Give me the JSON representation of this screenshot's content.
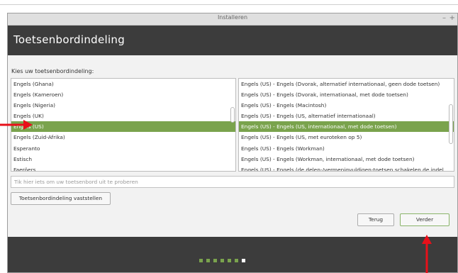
{
  "window": {
    "title": "Installeren",
    "min_symbol": "–",
    "close_symbol": "+"
  },
  "header": {
    "title": "Toetsenbordindeling"
  },
  "layout_label": "Kies uw toetsenbordindeling:",
  "layouts": [
    "Engels (Ghana)",
    "Engels (Kameroen)",
    "Engels (Nigeria)",
    "Engels (UK)",
    "Engels (US)",
    "Engels (Zuid-Afrika)",
    "Esperanto",
    "Estisch",
    "Faeröers"
  ],
  "selected_layout": "Engels (US)",
  "variants": [
    "Engels (US) - Engels (Dvorak, alternatief internationaal, geen dode toetsen)",
    "Engels (US) - Engels (Dvorak, internationaal, met dode toetsen)",
    "Engels (US) - Engels (Macintosh)",
    "Engels (US) - Engels (US, alternatief internationaal)",
    "Engels (US) - Engels (US, internationaal, met dode toetsen)",
    "Engels (US) - Engels (US, met euroteken op 5)",
    "Engels (US) - Engels (Workman)",
    "Engels (US) - Engels (Workman, internationaal, met dode toetsen)",
    "Engels (US) - Engels (de delen-/vermenigvuldigen-toetsen schakelen de indel"
  ],
  "selected_variant": "Engels (US) - Engels (US, internationaal, met dode toetsen)",
  "test_placeholder": "Tik hier iets om uw toetsenbord uit te proberen",
  "buttons": {
    "detect": "Toetsenbordindeling vaststellen",
    "back": "Terug",
    "next": "Verder"
  },
  "progress": {
    "total_steps": 7,
    "current_step": 7
  },
  "colors": {
    "accent": "#7aa34d",
    "header_bg": "#3c3c3c",
    "arrow": "#e8101a"
  }
}
